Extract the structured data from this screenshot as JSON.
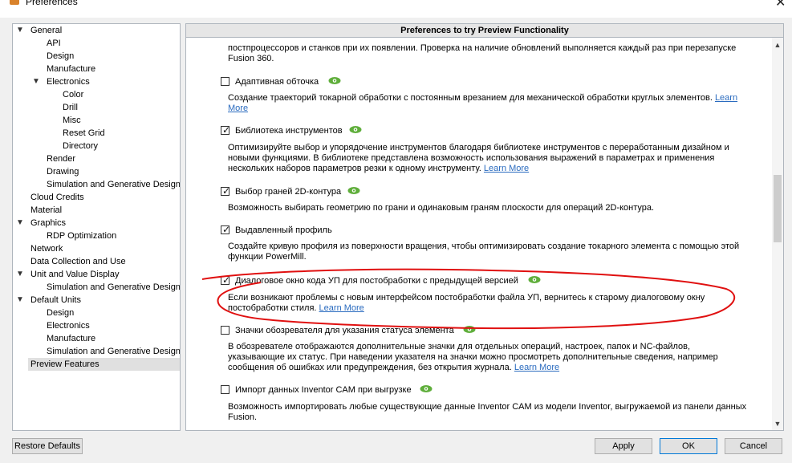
{
  "window": {
    "title": "Preferences"
  },
  "sidebar": {
    "items": [
      {
        "label": "General",
        "toggle": "▼"
      },
      {
        "label": "API"
      },
      {
        "label": "Design"
      },
      {
        "label": "Manufacture"
      },
      {
        "label": "Electronics",
        "toggle": "▼"
      },
      {
        "label": "Color"
      },
      {
        "label": "Drill"
      },
      {
        "label": "Misc"
      },
      {
        "label": "Reset Grid"
      },
      {
        "label": "Directory"
      },
      {
        "label": "Render"
      },
      {
        "label": "Drawing"
      },
      {
        "label": "Simulation and Generative Design"
      },
      {
        "label": "Cloud Credits"
      },
      {
        "label": "Material"
      },
      {
        "label": "Graphics",
        "toggle": "▼"
      },
      {
        "label": "RDP Optimization"
      },
      {
        "label": "Network"
      },
      {
        "label": "Data Collection and Use"
      },
      {
        "label": "Unit and Value Display",
        "toggle": "▼"
      },
      {
        "label": "Simulation and Generative Design"
      },
      {
        "label": "Default Units",
        "toggle": "▼"
      },
      {
        "label": "Design"
      },
      {
        "label": "Electronics"
      },
      {
        "label": "Manufacture"
      },
      {
        "label": "Simulation and Generative Design"
      },
      {
        "label": "Preview Features",
        "selected": true
      }
    ]
  },
  "panel": {
    "header": "Preferences to try Preview Functionality",
    "intro": {
      "line1": "постпроцессоров и станков при их появлении. Проверка на наличие обновлений выполняется каждый раз при перезапуске",
      "line2": "Fusion 360."
    },
    "features": [
      {
        "label": "Адаптивная обточка",
        "checked": false,
        "desc": "Создание траекторий токарной обработки с постоянным врезанием для механической обработки круглых элементов.",
        "link": "Learn More"
      },
      {
        "label": "Библиотека инструментов",
        "checked": true,
        "desc": "Оптимизируйте выбор и упорядочение инструментов благодаря библиотеке инструментов с переработанным дизайном и новыми функциями. В библиотеке представлена возможность использования выражений в параметрах и применения нескольких наборов параметров резки к одному инструменту.",
        "link": "Learn More"
      },
      {
        "label": "Выбор граней 2D-контура",
        "checked": true,
        "desc": "Возможность выбирать геометрию по грани и одинаковым граням плоскости для операций 2D-контура."
      },
      {
        "label": "Выдавленный профиль",
        "checked": true,
        "desc": "Создайте кривую профиля из поверхности вращения, чтобы оптимизировать создание токарного элемента с помощью этой функции PowerMill."
      },
      {
        "label": "Диалоговое окно кода УП для постобработки с предыдущей версией",
        "checked": true,
        "desc": "Если возникают проблемы с новым интерфейсом постобработки файла УП, вернитесь к старому диалоговому окну постобработки стиля.",
        "link": "Learn More"
      },
      {
        "label": "Значки обозревателя для указания статуса элемента",
        "checked": false,
        "desc": "В обозревателе отображаются дополнительные значки для отдельных операций, настроек, папок и NC-файлов, указывающие их статус. При наведении указателя на значки можно просмотреть дополнительные сведения, например сообщения об ошибках или предупреждения, без открытия журнала.",
        "link": "Learn More"
      },
      {
        "label": "Импорт данных Inventor CAM при выгрузке",
        "checked": false,
        "desc": "Возможность импортировать любые существующие данные Inventor CAM из модели Inventor, выгружаемой из панели данных Fusion."
      }
    ]
  },
  "buttons": {
    "restore": "Restore Defaults",
    "apply": "Apply",
    "ok": "OK",
    "cancel": "Cancel"
  },
  "colors": {
    "link": "#2a6bbf",
    "eye_icon": "#5fae3b",
    "annotation": "#e01010",
    "selected_bg": "#e0e0e0"
  }
}
